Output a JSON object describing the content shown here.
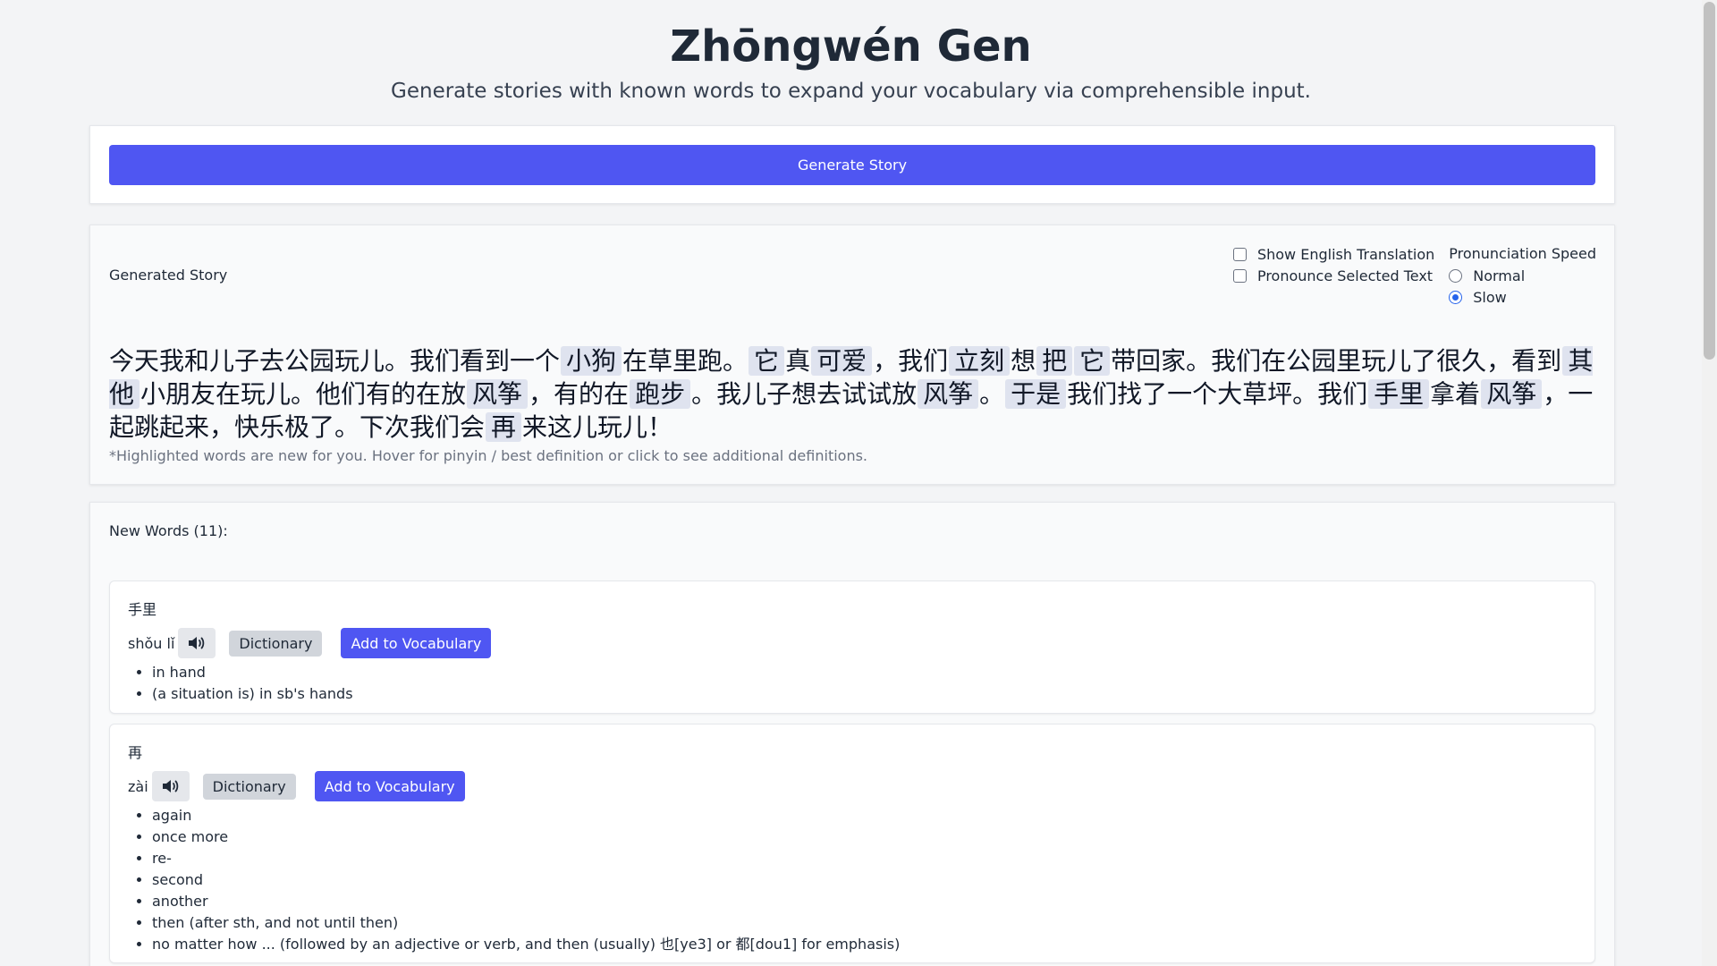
{
  "header": {
    "title": "Zhōngwén Gen",
    "subtitle": "Generate stories with known words to expand your vocabulary via comprehensible input."
  },
  "generate": {
    "button_label": "Generate Story"
  },
  "story": {
    "label": "Generated Story",
    "options": {
      "show_translation": {
        "label": "Show English Translation",
        "checked": false
      },
      "pronounce_selected": {
        "label": "Pronounce Selected Text",
        "checked": false
      },
      "speed_title": "Pronunciation Speed",
      "speed_options": [
        {
          "label": "Normal",
          "selected": false
        },
        {
          "label": "Slow",
          "selected": true
        }
      ]
    },
    "segments": [
      {
        "text": "今天我和儿子去公园玩儿。我们看到一个",
        "new": false
      },
      {
        "text": "小狗",
        "new": true
      },
      {
        "text": "在草里跑。",
        "new": false
      },
      {
        "text": "它",
        "new": true
      },
      {
        "text": "真",
        "new": false
      },
      {
        "text": "可爱",
        "new": true
      },
      {
        "text": "，我们",
        "new": false
      },
      {
        "text": "立刻",
        "new": true
      },
      {
        "text": "想",
        "new": false
      },
      {
        "text": "把",
        "new": true
      },
      {
        "text": "它",
        "new": true
      },
      {
        "text": "带回家。我们在公园里玩儿了很久，看到",
        "new": false
      },
      {
        "text": "其他",
        "new": true
      },
      {
        "text": "小朋友在玩儿。他们有的在放",
        "new": false
      },
      {
        "text": "风筝",
        "new": true
      },
      {
        "text": "，有的在",
        "new": false
      },
      {
        "text": "跑步",
        "new": true
      },
      {
        "text": "。我儿子想去试试放",
        "new": false
      },
      {
        "text": "风筝",
        "new": true
      },
      {
        "text": "。",
        "new": false
      },
      {
        "text": "于是",
        "new": true
      },
      {
        "text": "我们找了一个大草坪。我们",
        "new": false
      },
      {
        "text": "手里",
        "new": true
      },
      {
        "text": "拿着",
        "new": false
      },
      {
        "text": "风筝",
        "new": true
      },
      {
        "text": "，一起跳起来，快乐极了。下次我们会",
        "new": false
      },
      {
        "text": "再",
        "new": true
      },
      {
        "text": "来这儿玩儿！",
        "new": false
      }
    ],
    "note": "*Highlighted words are new for you. Hover for pinyin / best definition or click to see additional definitions."
  },
  "new_words": {
    "label": "New Words (11):",
    "speaker_icon": "speaker-icon",
    "dictionary_label": "Dictionary",
    "add_label": "Add to Vocabulary",
    "items": [
      {
        "hanzi": "手里",
        "pinyin": "shǒu lǐ",
        "definitions": [
          "in hand",
          "(a situation is) in sb's hands"
        ]
      },
      {
        "hanzi": "再",
        "pinyin": "zài",
        "definitions": [
          "again",
          "once more",
          "re-",
          "second",
          "another",
          "then (after sth, and not until then)",
          "no matter how ... (followed by an adjective or verb, and then (usually) 也[ye3] or 都[dou1] for emphasis)"
        ]
      }
    ]
  },
  "colors": {
    "accent": "#4f56f2",
    "highlight": "#dfe3ef",
    "background": "#f3f4f6"
  }
}
